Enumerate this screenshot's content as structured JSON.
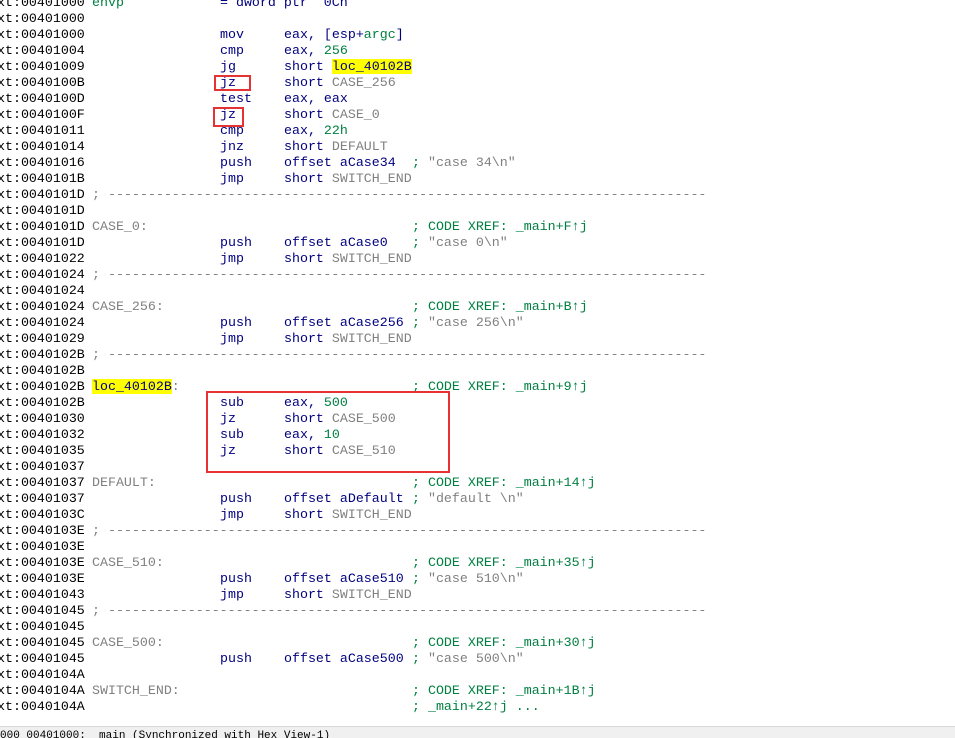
{
  "colors": {
    "mnemonic": "#000080",
    "number": "#008040",
    "name": "#808080",
    "comment": "#008040",
    "highlight": "#ffff00",
    "annotation_box": "#e53333"
  },
  "addr_prefix": "xt:",
  "separator": "; ----------------------------------------------------------------------------",
  "rows": [
    {
      "addr": "00401000",
      "label": "envp",
      "label_green": true,
      "mnem": "= dword ptr  0Ch"
    },
    {
      "addr": "00401000"
    },
    {
      "addr": "00401000",
      "mnem": "mov",
      "ops": [
        [
          "eax, [esp+",
          ""
        ],
        [
          "argc",
          "num"
        ],
        [
          "]",
          ""
        ]
      ]
    },
    {
      "addr": "00401004",
      "mnem": "cmp",
      "ops": [
        [
          "eax, ",
          ""
        ],
        [
          "256",
          "num"
        ]
      ]
    },
    {
      "addr": "00401009",
      "mnem": "jg",
      "ops": [
        [
          "short ",
          ""
        ],
        [
          "loc_40102B",
          "hl"
        ]
      ]
    },
    {
      "addr": "0040100B",
      "mnem": "jz",
      "ops": [
        [
          "short ",
          ""
        ],
        [
          "CASE_256",
          "name"
        ]
      ]
    },
    {
      "addr": "0040100D",
      "mnem": "test",
      "ops": [
        [
          "eax, eax",
          ""
        ]
      ]
    },
    {
      "addr": "0040100F",
      "mnem": "jz",
      "ops": [
        [
          "short ",
          ""
        ],
        [
          "CASE_0",
          "name"
        ]
      ]
    },
    {
      "addr": "00401011",
      "mnem": "cmp",
      "ops": [
        [
          "eax, ",
          ""
        ],
        [
          "22h",
          "num"
        ]
      ]
    },
    {
      "addr": "00401014",
      "mnem": "jnz",
      "ops": [
        [
          "short ",
          ""
        ],
        [
          "DEFAULT",
          "name"
        ]
      ]
    },
    {
      "addr": "00401016",
      "mnem": "push",
      "ops": [
        [
          "offset aCase34",
          ""
        ]
      ],
      "cmt": [
        [
          "; ",
          ""
        ],
        [
          "\"case 34\\n\"",
          "str"
        ]
      ]
    },
    {
      "addr": "0040101B",
      "mnem": "jmp",
      "ops": [
        [
          "short ",
          ""
        ],
        [
          "SWITCH_END",
          "name"
        ]
      ]
    },
    {
      "addr": "0040101D",
      "sep": true
    },
    {
      "addr": "0040101D"
    },
    {
      "addr": "0040101D",
      "label": "CASE_0:",
      "cmt": [
        [
          "; CODE XREF: _main+F↑j",
          ""
        ]
      ]
    },
    {
      "addr": "0040101D",
      "mnem": "push",
      "ops": [
        [
          "offset aCase0",
          ""
        ]
      ],
      "cmt": [
        [
          "; ",
          ""
        ],
        [
          "\"case 0\\n\"",
          "str"
        ]
      ]
    },
    {
      "addr": "00401022",
      "mnem": "jmp",
      "ops": [
        [
          "short ",
          ""
        ],
        [
          "SWITCH_END",
          "name"
        ]
      ]
    },
    {
      "addr": "00401024",
      "sep": true
    },
    {
      "addr": "00401024"
    },
    {
      "addr": "00401024",
      "label": "CASE_256:",
      "cmt": [
        [
          "; CODE XREF: _main+B↑j",
          ""
        ]
      ]
    },
    {
      "addr": "00401024",
      "mnem": "push",
      "ops": [
        [
          "offset aCase256",
          ""
        ]
      ],
      "cmt": [
        [
          "; ",
          ""
        ],
        [
          "\"case 256\\n\"",
          "str"
        ]
      ]
    },
    {
      "addr": "00401029",
      "mnem": "jmp",
      "ops": [
        [
          "short ",
          ""
        ],
        [
          "SWITCH_END",
          "name"
        ]
      ]
    },
    {
      "addr": "0040102B",
      "sep": true
    },
    {
      "addr": "0040102B"
    },
    {
      "addr": "0040102B",
      "label": "loc_40102B",
      "label_hl": true,
      "label_suffix": ":",
      "cmt": [
        [
          "; CODE XREF: _main+9↑j",
          ""
        ]
      ]
    },
    {
      "addr": "0040102B",
      "mnem": "sub",
      "ops": [
        [
          "eax, ",
          ""
        ],
        [
          "500",
          "num"
        ]
      ]
    },
    {
      "addr": "00401030",
      "mnem": "jz",
      "ops": [
        [
          "short ",
          ""
        ],
        [
          "CASE_500",
          "name"
        ]
      ]
    },
    {
      "addr": "00401032",
      "mnem": "sub",
      "ops": [
        [
          "eax, ",
          ""
        ],
        [
          "10",
          "num"
        ]
      ]
    },
    {
      "addr": "00401035",
      "mnem": "jz",
      "ops": [
        [
          "short ",
          ""
        ],
        [
          "CASE_510",
          "name"
        ]
      ]
    },
    {
      "addr": "00401037"
    },
    {
      "addr": "00401037",
      "label": "DEFAULT:",
      "cmt": [
        [
          "; CODE XREF: _main+14↑j",
          ""
        ]
      ]
    },
    {
      "addr": "00401037",
      "mnem": "push",
      "ops": [
        [
          "offset aDefault",
          ""
        ]
      ],
      "cmt": [
        [
          "; ",
          ""
        ],
        [
          "\"default \\n\"",
          "str"
        ]
      ]
    },
    {
      "addr": "0040103C",
      "mnem": "jmp",
      "ops": [
        [
          "short ",
          ""
        ],
        [
          "SWITCH_END",
          "name"
        ]
      ]
    },
    {
      "addr": "0040103E",
      "sep": true
    },
    {
      "addr": "0040103E"
    },
    {
      "addr": "0040103E",
      "label": "CASE_510:",
      "cmt": [
        [
          "; CODE XREF: _main+35↑j",
          ""
        ]
      ]
    },
    {
      "addr": "0040103E",
      "mnem": "push",
      "ops": [
        [
          "offset aCase510",
          ""
        ]
      ],
      "cmt": [
        [
          "; ",
          ""
        ],
        [
          "\"case 510\\n\"",
          "str"
        ]
      ]
    },
    {
      "addr": "00401043",
      "mnem": "jmp",
      "ops": [
        [
          "short ",
          ""
        ],
        [
          "SWITCH_END",
          "name"
        ]
      ]
    },
    {
      "addr": "00401045",
      "sep": true
    },
    {
      "addr": "00401045"
    },
    {
      "addr": "00401045",
      "label": "CASE_500:",
      "cmt": [
        [
          "; CODE XREF: _main+30↑j",
          ""
        ]
      ]
    },
    {
      "addr": "00401045",
      "mnem": "push",
      "ops": [
        [
          "offset aCase500",
          ""
        ]
      ],
      "cmt": [
        [
          "; ",
          ""
        ],
        [
          "\"case 500\\n\"",
          "str"
        ]
      ]
    },
    {
      "addr": "0040104A"
    },
    {
      "addr": "0040104A",
      "label": "SWITCH_END:",
      "cmt": [
        [
          "; CODE XREF: _main+1B↑j",
          ""
        ]
      ]
    },
    {
      "addr": "0040104A",
      "cmt": [
        [
          "; _main+22↑j ...",
          ""
        ]
      ]
    }
  ],
  "status": {
    "text": "000 00401000: _main (Synchronized with Hex View-1)"
  }
}
